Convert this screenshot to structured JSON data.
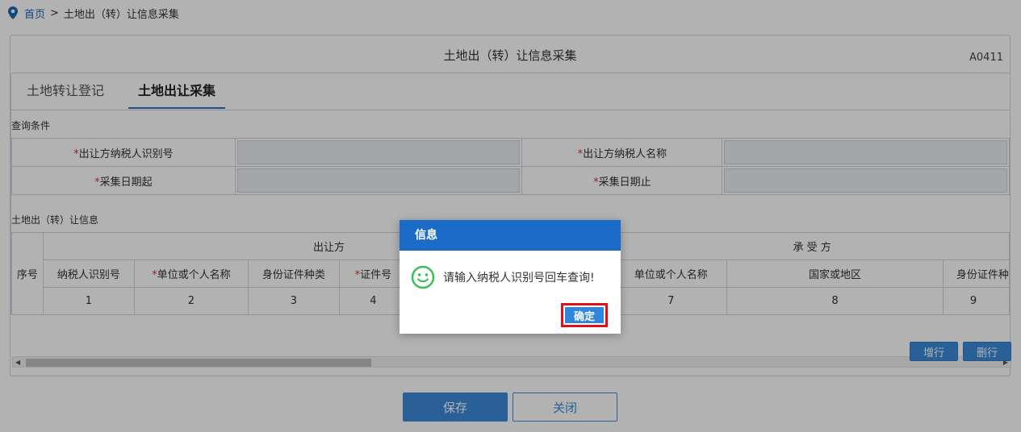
{
  "breadcrumb": {
    "home": "首页",
    "separator": ">",
    "current": "土地出（转）让信息采集"
  },
  "panel": {
    "title": "土地出（转）让信息采集",
    "code": "A0411"
  },
  "tabs": [
    {
      "label": "土地转让登记",
      "active": false
    },
    {
      "label": "土地出让采集",
      "active": true
    }
  ],
  "query": {
    "section_label": "查询条件",
    "fields": [
      {
        "required": "*",
        "label": "出让方纳税人识别号",
        "value": ""
      },
      {
        "required": "*",
        "label": "出让方纳税人名称",
        "value": ""
      },
      {
        "required": "*",
        "label": "采集日期起",
        "value": ""
      },
      {
        "required": "*",
        "label": "采集日期止",
        "value": ""
      }
    ]
  },
  "info": {
    "section_label": "土地出（转）让信息",
    "seq_header": "序号",
    "group_transferor": "出让方",
    "group_transferee": "承 受 方",
    "columns": [
      {
        "required": "",
        "label": "纳税人识别号",
        "num": "1"
      },
      {
        "required": "*",
        "label": "单位或个人名称",
        "num": "2"
      },
      {
        "required": "",
        "label": "身份证件种类",
        "num": "3"
      },
      {
        "required": "*",
        "label": "证件号",
        "num": "4"
      },
      {
        "required": "",
        "label": "单位或个人名称",
        "num": "7"
      },
      {
        "required": "",
        "label": "国家或地区",
        "num": "8"
      },
      {
        "required": "",
        "label": "身份证件种",
        "num": "9"
      }
    ]
  },
  "buttons": {
    "add_row": "增行",
    "delete_row": "删行",
    "save": "保存",
    "close": "关闭"
  },
  "dialog": {
    "title": "信息",
    "message": "请输入纳税人识别号回车查询!",
    "ok": "确定"
  },
  "colors": {
    "primary": "#1b6cc6",
    "button": "#3b8ad9",
    "required": "#e03030",
    "highlight": "#e0101a",
    "smile": "#3cbf5a"
  }
}
